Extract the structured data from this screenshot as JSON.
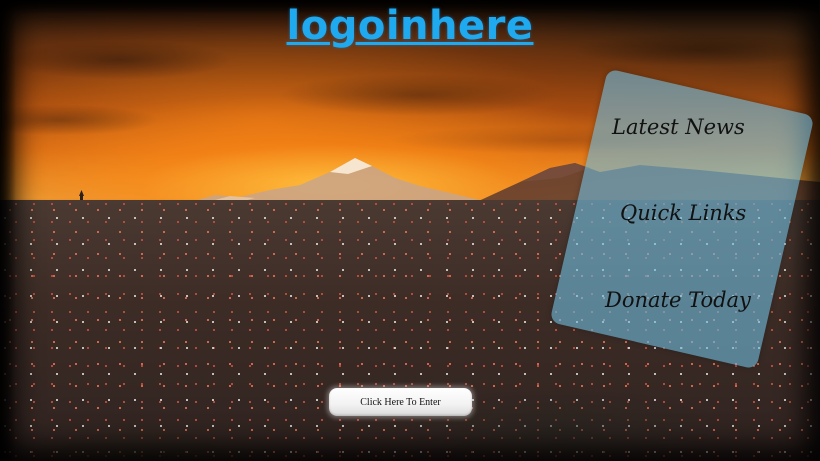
{
  "logo": {
    "text": "logoinhere",
    "color": "#1fa9ee"
  },
  "menu": {
    "items": [
      {
        "label": "Latest News"
      },
      {
        "label": "Quick Links"
      },
      {
        "label": "Donate Today"
      }
    ],
    "panel_color": "#6eb9dc"
  },
  "enter_button": {
    "label": "Click Here To Enter"
  },
  "background": {
    "description_icon": "sunset-city-mountain-photo"
  }
}
